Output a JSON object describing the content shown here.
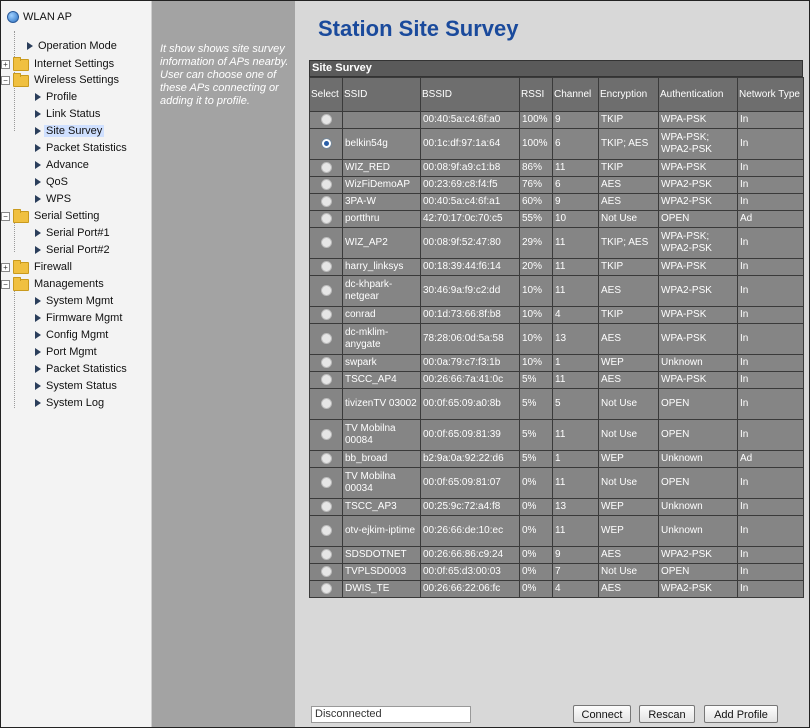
{
  "tree": {
    "root": "WLAN AP",
    "items": [
      {
        "label": "Operation Mode"
      },
      {
        "label": "Internet Settings"
      },
      {
        "label": "Wireless Settings"
      },
      {
        "label": "Profile"
      },
      {
        "label": "Link Status"
      },
      {
        "label": "Site Survey"
      },
      {
        "label": "Packet Statistics"
      },
      {
        "label": "Advance"
      },
      {
        "label": "QoS"
      },
      {
        "label": "WPS"
      },
      {
        "label": "Serial Setting"
      },
      {
        "label": "Serial Port#1"
      },
      {
        "label": "Serial Port#2"
      },
      {
        "label": "Firewall"
      },
      {
        "label": "Managements"
      },
      {
        "label": "System Mgmt"
      },
      {
        "label": "Firmware Mgmt"
      },
      {
        "label": "Config Mgmt"
      },
      {
        "label": "Port Mgmt"
      },
      {
        "label": "Packet Statistics"
      },
      {
        "label": "System Status"
      },
      {
        "label": "System Log"
      }
    ]
  },
  "help": {
    "text": "It show shows site survey information of APs nearby. User can choose one of these APs connecting or adding it to profile."
  },
  "main": {
    "title": "Station Site Survey",
    "caption": "Site Survey",
    "columns": [
      "Select",
      "SSID",
      "BSSID",
      "RSSI",
      "Channel",
      "Encryption",
      "Authentication",
      "Network Type"
    ],
    "rows": [
      {
        "ssid": "",
        "bssid": "00:40:5a:c4:6f:a0",
        "rssi": "100%",
        "channel": "9",
        "enc": "TKIP",
        "auth": "WPA-PSK",
        "type": "In"
      },
      {
        "ssid": "belkin54g",
        "bssid": "00:1c:df:97:1a:64",
        "rssi": "100%",
        "channel": "6",
        "enc": "TKIP; AES",
        "auth": "WPA-PSK; WPA2-PSK",
        "type": "In"
      },
      {
        "ssid": "WIZ_RED",
        "bssid": "00:08:9f:a9:c1:b8",
        "rssi": "86%",
        "channel": "11",
        "enc": "TKIP",
        "auth": "WPA-PSK",
        "type": "In"
      },
      {
        "ssid": "WizFiDemoAP",
        "bssid": "00:23:69:c8:f4:f5",
        "rssi": "76%",
        "channel": "6",
        "enc": "AES",
        "auth": "WPA2-PSK",
        "type": "In"
      },
      {
        "ssid": "3PA-W",
        "bssid": "00:40:5a:c4:6f:a1",
        "rssi": "60%",
        "channel": "9",
        "enc": "AES",
        "auth": "WPA2-PSK",
        "type": "In"
      },
      {
        "ssid": "portthru",
        "bssid": "42:70:17:0c:70:c5",
        "rssi": "55%",
        "channel": "10",
        "enc": "Not Use",
        "auth": "OPEN",
        "type": "Ad"
      },
      {
        "ssid": "WIZ_AP2",
        "bssid": "00:08:9f:52:47:80",
        "rssi": "29%",
        "channel": "11",
        "enc": "TKIP; AES",
        "auth": "WPA-PSK; WPA2-PSK",
        "type": "In"
      },
      {
        "ssid": "harry_linksys",
        "bssid": "00:18:39:44:f6:14",
        "rssi": "20%",
        "channel": "11",
        "enc": "TKIP",
        "auth": "WPA-PSK",
        "type": "In"
      },
      {
        "ssid": "dc-khpark-netgear",
        "bssid": "30:46:9a:f9:c2:dd",
        "rssi": "10%",
        "channel": "11",
        "enc": "AES",
        "auth": "WPA2-PSK",
        "type": "In"
      },
      {
        "ssid": "conrad",
        "bssid": "00:1d:73:66:8f:b8",
        "rssi": "10%",
        "channel": "4",
        "enc": "TKIP",
        "auth": "WPA-PSK",
        "type": "In"
      },
      {
        "ssid": "dc-mklim-anygate",
        "bssid": "78:28:06:0d:5a:58",
        "rssi": "10%",
        "channel": "13",
        "enc": "AES",
        "auth": "WPA-PSK",
        "type": "In"
      },
      {
        "ssid": "swpark",
        "bssid": "00:0a:79:c7:f3:1b",
        "rssi": "10%",
        "channel": "1",
        "enc": "WEP",
        "auth": "Unknown",
        "type": "In"
      },
      {
        "ssid": "TSCC_AP4",
        "bssid": "00:26:66:7a:41:0c",
        "rssi": "5%",
        "channel": "11",
        "enc": "AES",
        "auth": "WPA-PSK",
        "type": "In"
      },
      {
        "ssid": "tivizenTV 03002",
        "bssid": "00:0f:65:09:a0:8b",
        "rssi": "5%",
        "channel": "5",
        "enc": "Not Use",
        "auth": "OPEN",
        "type": "In"
      },
      {
        "ssid": "TV Mobilna 00084",
        "bssid": "00:0f:65:09:81:39",
        "rssi": "5%",
        "channel": "11",
        "enc": "Not Use",
        "auth": "OPEN",
        "type": "In"
      },
      {
        "ssid": "bb_broad",
        "bssid": "b2:9a:0a:92:22:d6",
        "rssi": "5%",
        "channel": "1",
        "enc": "WEP",
        "auth": "Unknown",
        "type": "Ad"
      },
      {
        "ssid": "TV Mobilna 00034",
        "bssid": "00:0f:65:09:81:07",
        "rssi": "0%",
        "channel": "11",
        "enc": "Not Use",
        "auth": "OPEN",
        "type": "In"
      },
      {
        "ssid": "TSCC_AP3",
        "bssid": "00:25:9c:72:a4:f8",
        "rssi": "0%",
        "channel": "13",
        "enc": "WEP",
        "auth": "Unknown",
        "type": "In"
      },
      {
        "ssid": "otv-ejkim-iptime",
        "bssid": "00:26:66:de:10:ec",
        "rssi": "0%",
        "channel": "11",
        "enc": "WEP",
        "auth": "Unknown",
        "type": "In"
      },
      {
        "ssid": "SDSDOTNET",
        "bssid": "00:26:66:86:c9:24",
        "rssi": "0%",
        "channel": "9",
        "enc": "AES",
        "auth": "WPA2-PSK",
        "type": "In"
      },
      {
        "ssid": "TVPLSD0003",
        "bssid": "00:0f:65:d3:00:03",
        "rssi": "0%",
        "channel": "7",
        "enc": "Not Use",
        "auth": "OPEN",
        "type": "In"
      },
      {
        "ssid": "DWIS_TE",
        "bssid": "00:26:66:22:06:fc",
        "rssi": "0%",
        "channel": "4",
        "enc": "AES",
        "auth": "WPA2-PSK",
        "type": "In"
      }
    ],
    "selected_row": 1
  },
  "footer": {
    "status": "Disconnected",
    "connect": "Connect",
    "rescan": "Rescan",
    "add_profile": "Add Profile"
  },
  "colors": {
    "title": "#1a4a9c",
    "help_bg": "#a3a3a3",
    "main_bg": "#d8d8d8",
    "cell_bg": "#858585",
    "header_bg": "#6e6e6e"
  }
}
